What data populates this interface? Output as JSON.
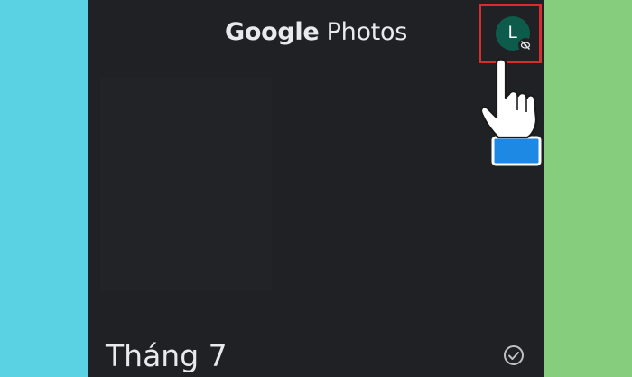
{
  "app": {
    "title_brand": "Google",
    "title_product": "Photos"
  },
  "account": {
    "avatar_letter": "L",
    "avatar_color": "#0d5c4b",
    "badge_icon": "incognito-off-icon"
  },
  "highlight": {
    "color": "#d62d2d"
  },
  "section": {
    "title": "Tháng 7",
    "select_icon": "check-circle-icon"
  },
  "overlay": {
    "cursor_icon": "pointing-hand-icon"
  }
}
